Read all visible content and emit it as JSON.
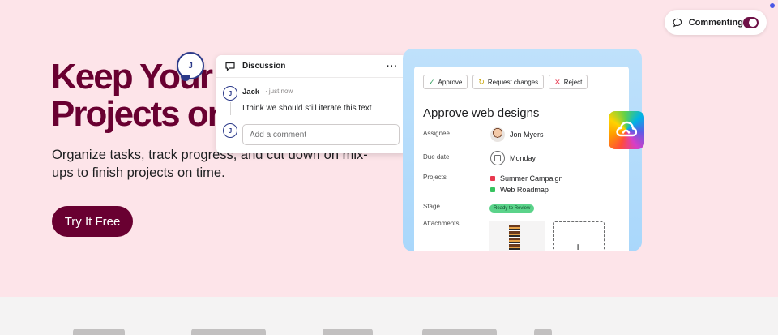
{
  "commenting": {
    "label": "Commenting",
    "enabled": true
  },
  "hero": {
    "headline_line1": "Keep Your",
    "headline_line2": "Projects on",
    "subtext": "Organize tasks, track progress, and cut down on mix-ups to finish projects on time.",
    "cta_label": "Try It Free"
  },
  "floating_avatar": {
    "initial": "J"
  },
  "discussion": {
    "title": "Discussion",
    "menu": "···",
    "comment": {
      "initial": "J",
      "author": "Jack",
      "time": "· just now",
      "text": "I think we should still iterate this text"
    },
    "reply": {
      "initial": "J",
      "placeholder": "Add a comment"
    }
  },
  "task": {
    "actions": [
      {
        "glyph": "✓",
        "label": "Approve"
      },
      {
        "glyph": "↻",
        "label": "Request changes"
      },
      {
        "glyph": "✕",
        "label": "Reject"
      }
    ],
    "title": "Approve web designs",
    "fields": {
      "assignee_label": "Assignee",
      "assignee_value": "Jon Myers",
      "due_label": "Due date",
      "due_value": "Monday",
      "projects_label": "Projects",
      "projects": [
        {
          "name": "Summer Campaign",
          "color": "#e8384f"
        },
        {
          "name": "Web Roadmap",
          "color": "#37c35f"
        }
      ],
      "stage_label": "Stage",
      "stage_value": "Ready to Review",
      "attachments_label": "Attachments",
      "add_glyph": "+"
    }
  },
  "colors": {
    "brand": "#690031",
    "background": "#fde4e9",
    "toggle": "#6d1146"
  },
  "icons": [
    "comment-bubble-icon",
    "chat-icon",
    "check-icon",
    "refresh-icon",
    "x-icon",
    "calendar-icon",
    "creative-cloud-icon",
    "plus-icon"
  ]
}
